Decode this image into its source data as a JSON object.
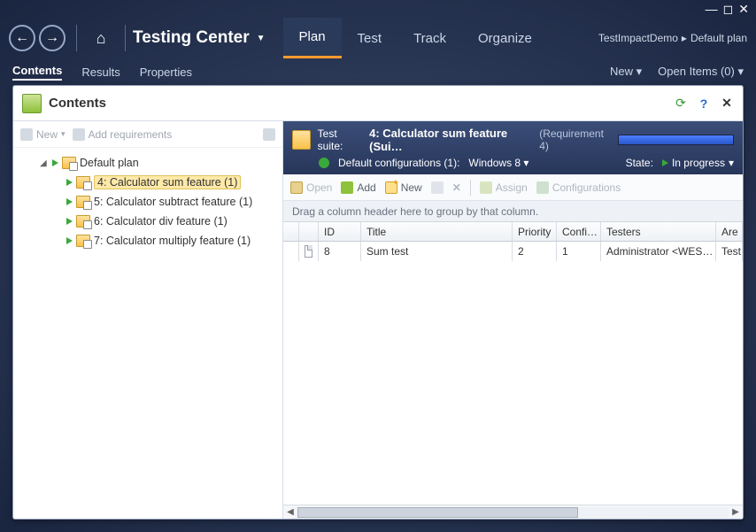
{
  "window": {
    "min": "—",
    "max": "◻",
    "close": "✕"
  },
  "header": {
    "app_title": "Testing Center",
    "tabs": [
      "Plan",
      "Test",
      "Track",
      "Organize"
    ],
    "active_tab": 0,
    "breadcrumb": {
      "project": "TestImpactDemo",
      "plan": "Default plan"
    }
  },
  "subheader": {
    "tabs": [
      "Contents",
      "Results",
      "Properties"
    ],
    "active": 0,
    "new_label": "New",
    "open_items_label": "Open Items (0)"
  },
  "panel": {
    "title": "Contents"
  },
  "tree": {
    "toolbar": {
      "new": "New",
      "add_req": "Add requirements"
    },
    "root": {
      "label": "Default plan"
    },
    "items": [
      {
        "label": "4: Calculator sum feature (1)",
        "selected": true
      },
      {
        "label": "5: Calculator subtract feature (1)",
        "selected": false
      },
      {
        "label": "6: Calculator div feature (1)",
        "selected": false
      },
      {
        "label": "7: Calculator multiply feature (1)",
        "selected": false
      }
    ]
  },
  "suite": {
    "prefix": "Test suite:",
    "title": "4: Calculator sum feature (Sui…",
    "requirement": "(Requirement 4)",
    "config_label": "Default configurations (1):",
    "config_value": "Windows 8",
    "state_label": "State:",
    "state_value": "In progress"
  },
  "toolbar": {
    "open": "Open",
    "add": "Add",
    "new": "New",
    "assign": "Assign",
    "configs": "Configurations"
  },
  "group_hint": "Drag a column header here to group by that column.",
  "columns": {
    "id": "ID",
    "title": "Title",
    "priority": "Priority",
    "config": "Confi…",
    "testers": "Testers",
    "area": "Are"
  },
  "rows": [
    {
      "id": "8",
      "title": "Sum test",
      "priority": "2",
      "config": "1",
      "testers": "Administrator <WES…",
      "area": "Test"
    }
  ]
}
